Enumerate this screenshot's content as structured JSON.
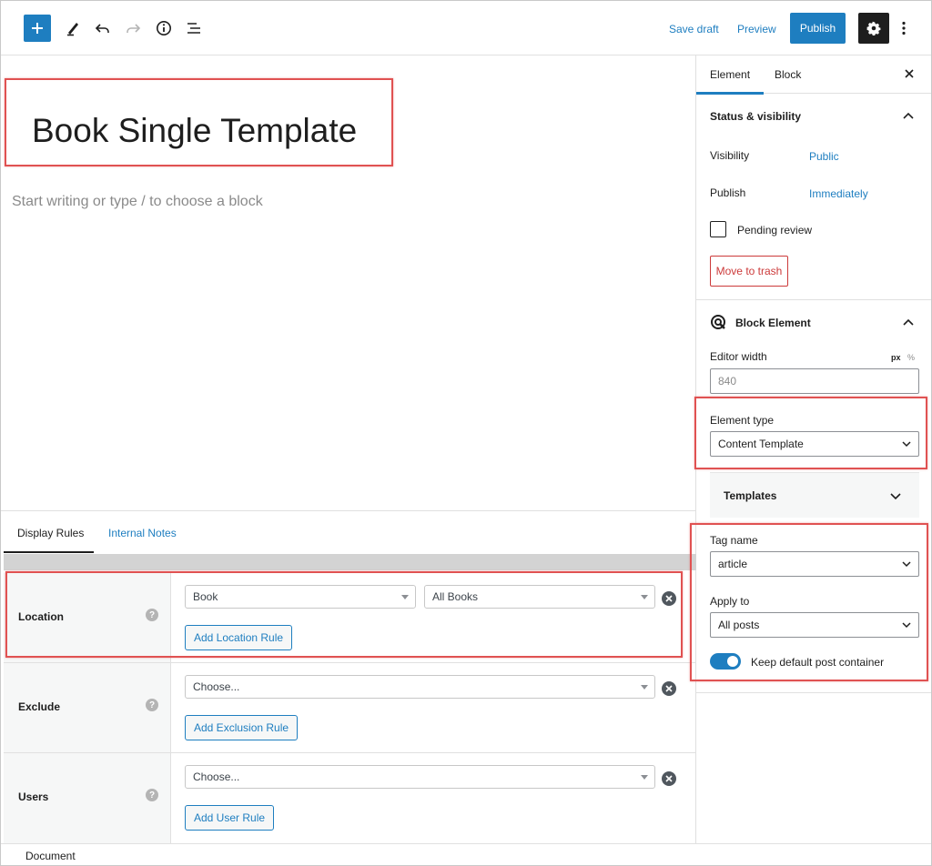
{
  "toolbar": {
    "save_draft": "Save draft",
    "preview": "Preview",
    "publish": "Publish"
  },
  "editor": {
    "title": "Book Single Template",
    "placeholder": "Start writing or type / to choose a block"
  },
  "metabox": {
    "tabs": [
      "Display Rules",
      "Internal Notes"
    ],
    "rules": [
      {
        "label": "Location",
        "selects": [
          "Book",
          "All Books"
        ],
        "button": "Add Location Rule"
      },
      {
        "label": "Exclude",
        "selects": [
          "Choose..."
        ],
        "button": "Add Exclusion Rule"
      },
      {
        "label": "Users",
        "selects": [
          "Choose..."
        ],
        "button": "Add User Rule"
      }
    ],
    "help_glyph": "?"
  },
  "footer": {
    "breadcrumb": "Document"
  },
  "sidebar": {
    "tabs": [
      "Element",
      "Block"
    ],
    "status_panel": {
      "title": "Status & visibility",
      "visibility_label": "Visibility",
      "visibility_value": "Public",
      "publish_label": "Publish",
      "publish_value": "Immediately",
      "pending_review": "Pending review",
      "trash": "Move to trash"
    },
    "block_element": {
      "title": "Block Element",
      "editor_width_label": "Editor width",
      "unit_px": "px",
      "unit_pct": "%",
      "editor_width_value": "840",
      "element_type_label": "Element type",
      "element_type_value": "Content Template",
      "templates_title": "Templates",
      "tag_name_label": "Tag name",
      "tag_name_value": "article",
      "apply_to_label": "Apply to",
      "apply_to_value": "All posts",
      "keep_container_label": "Keep default post container"
    }
  },
  "colors": {
    "accent": "#1e7ec0",
    "highlight": "#e05252",
    "trash": "#cc3a3a"
  }
}
